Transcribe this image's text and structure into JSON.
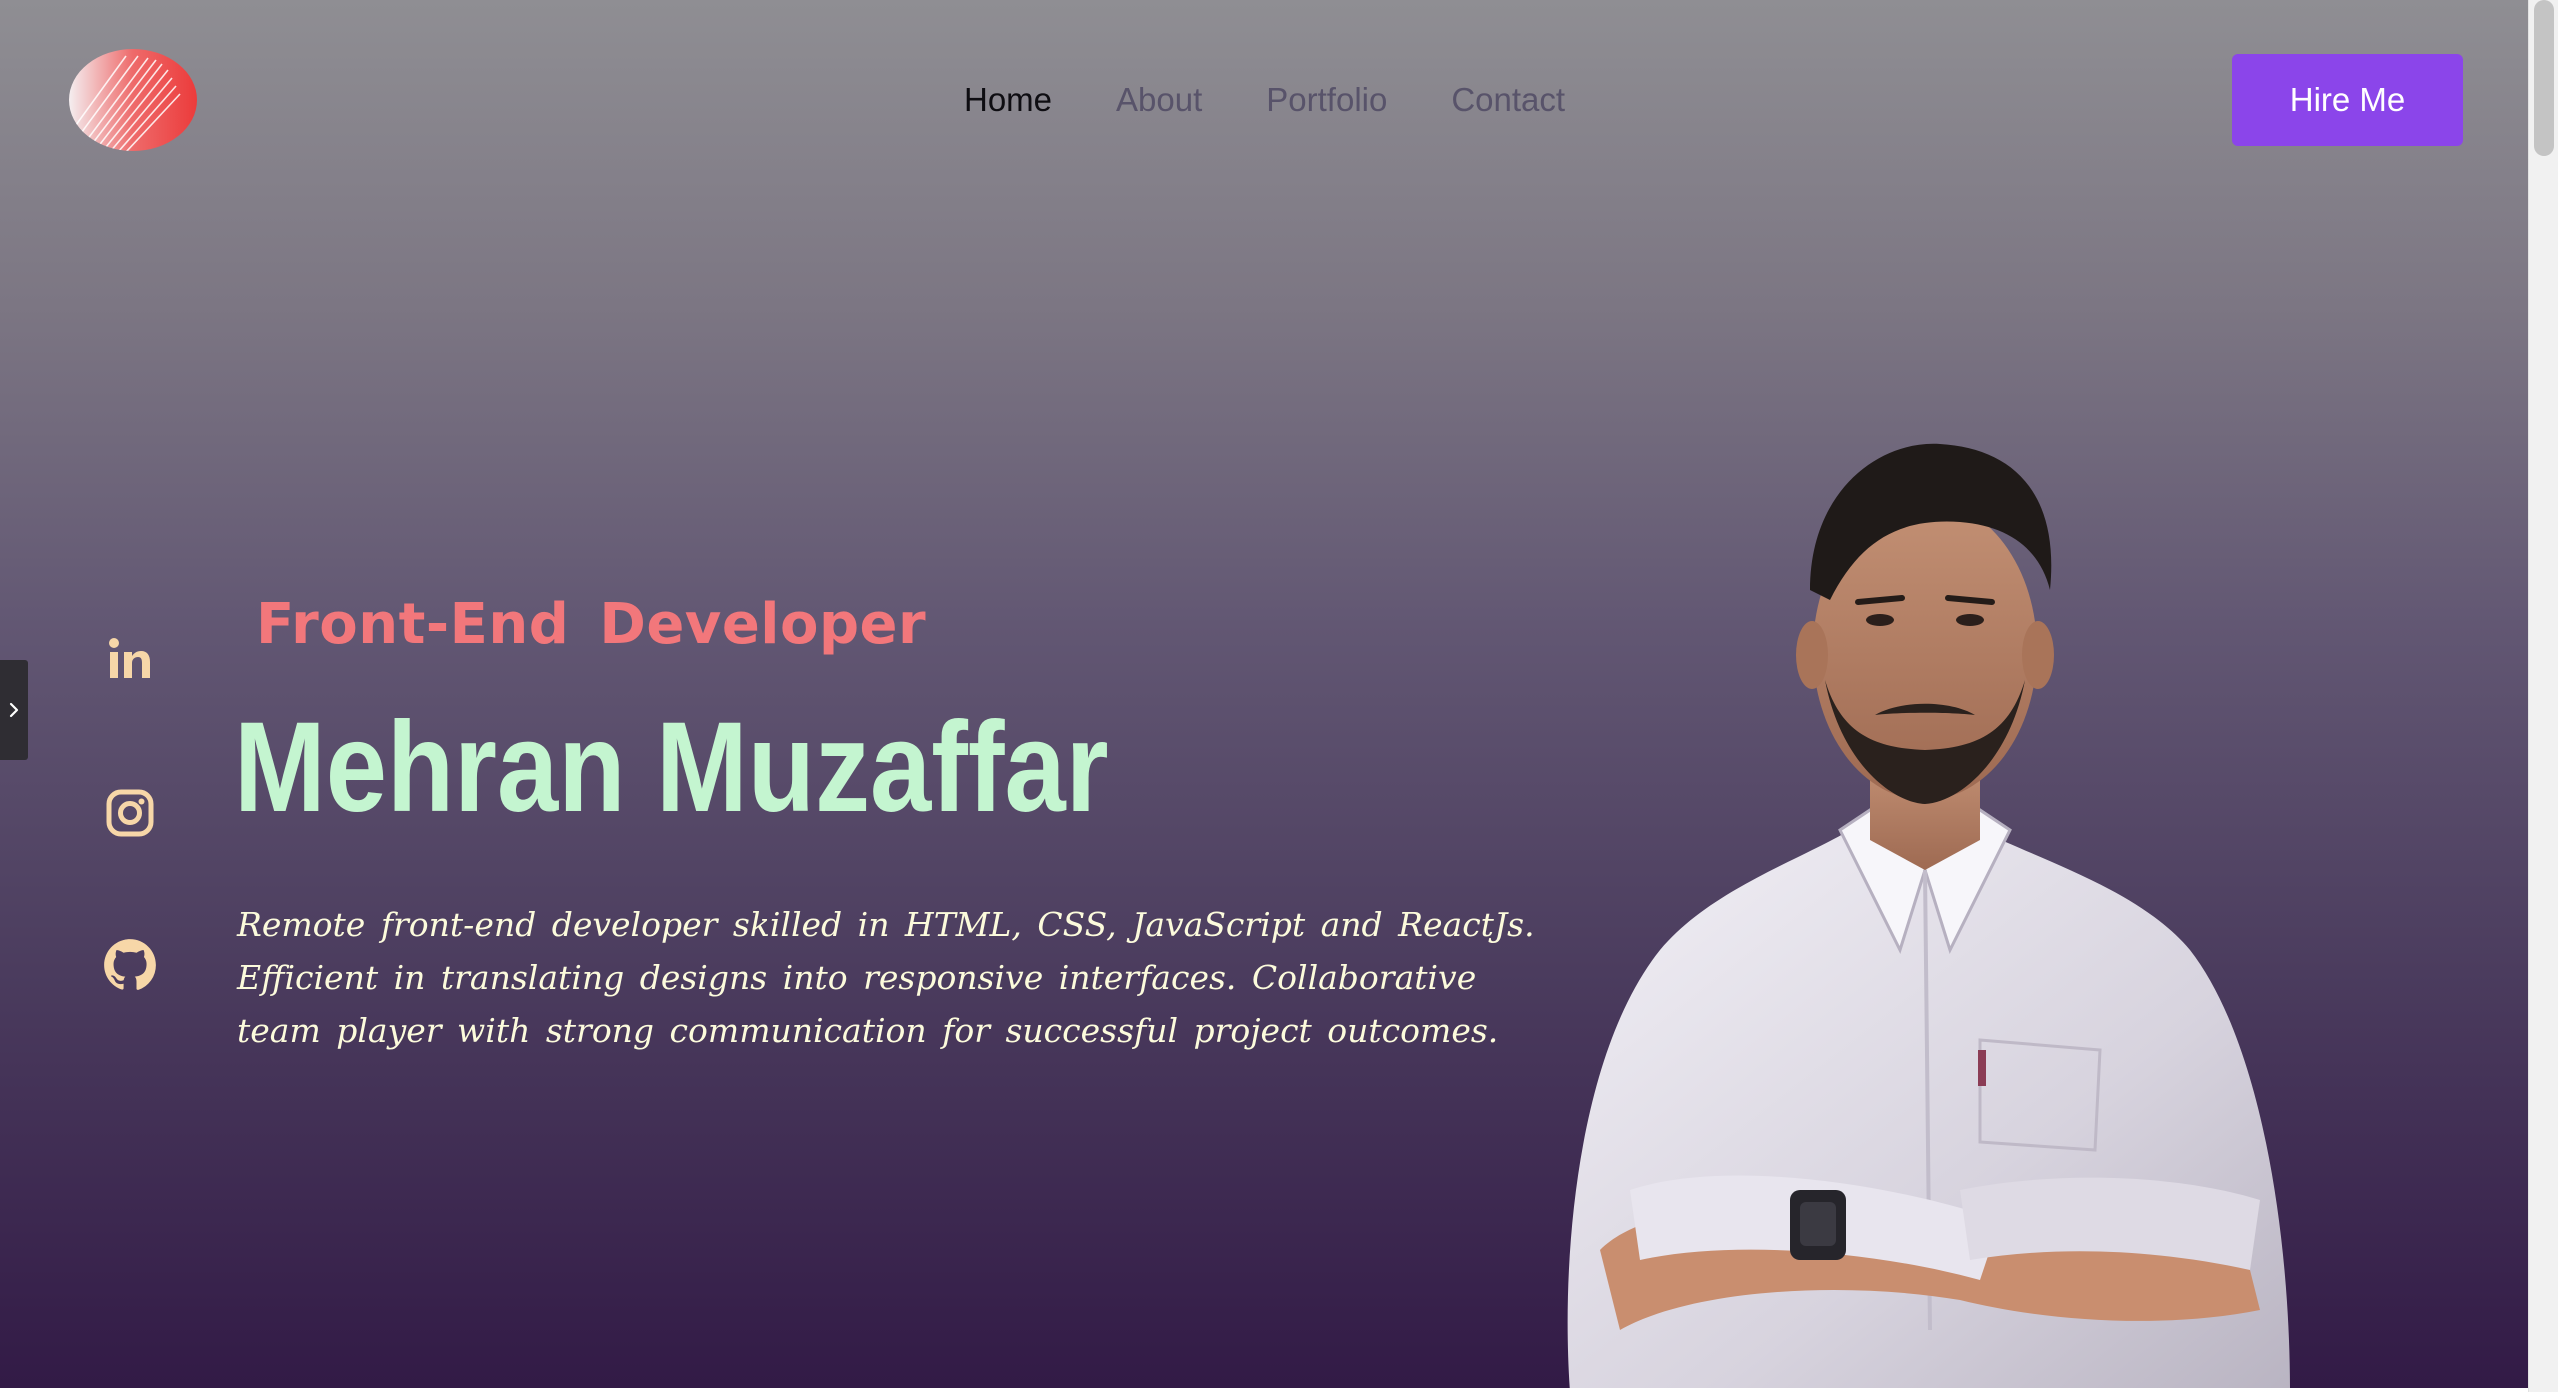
{
  "nav": {
    "items": [
      {
        "label": "Home",
        "active": true
      },
      {
        "label": "About",
        "active": false
      },
      {
        "label": "Portfolio",
        "active": false
      },
      {
        "label": "Contact",
        "active": false
      }
    ],
    "cta_label": "Hire Me"
  },
  "hero": {
    "role": "Front-End Developer",
    "name": "Mehran Muzaffar",
    "bio_lines": [
      "Remote front-end developer skilled in HTML, CSS, JavaScript and ReactJs.",
      "Efficient in translating designs into responsive interfaces. Collaborative",
      "team player with strong communication for successful project outcomes."
    ]
  },
  "social": [
    "linkedin-icon",
    "instagram-icon",
    "github-icon"
  ],
  "colors": {
    "accent": "#8b45ea",
    "role_text": "#f2777b",
    "name_text": "#c4f5d0",
    "bio_text": "#fcfbdc",
    "social_icon": "#f7d7a8",
    "nav_active": "#0e0d12",
    "nav_inactive": "#58536a"
  }
}
